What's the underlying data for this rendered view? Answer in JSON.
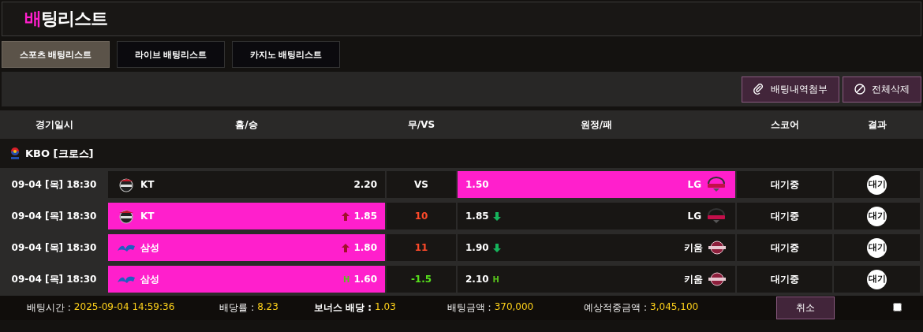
{
  "title": {
    "accent": "배",
    "rest": "팅리스트"
  },
  "tabs": [
    {
      "label": "스포츠 배팅리스트",
      "selected": true
    },
    {
      "label": "라이브 배팅리스트",
      "selected": false
    },
    {
      "label": "카지노 배팅리스트",
      "selected": false
    }
  ],
  "toolbar": [
    {
      "label": "배팅내역첨부",
      "kind": "attach"
    },
    {
      "label": "전체삭제",
      "kind": "delete"
    }
  ],
  "columns": [
    "경기일시",
    "홈/승",
    "무/VS",
    "원정/패",
    "스코어",
    "결과"
  ],
  "league": {
    "name": "KBO [크로스]"
  },
  "rows": [
    {
      "date": "09-04 [목] 18:30",
      "home": {
        "name": "KT",
        "kind": "dark-badge",
        "odds": "2.20",
        "selected": false
      },
      "draw": {
        "text": "VS",
        "kind": "vs"
      },
      "away": {
        "name": "LG",
        "kind": "arc-badge",
        "odds": "1.50",
        "selected": true
      },
      "score": "대기중",
      "result": "대기"
    },
    {
      "date": "09-04 [목] 18:30",
      "home": {
        "name": "KT",
        "kind": "dark-badge",
        "odds": "1.85",
        "selected": true,
        "trend": {
          "kind": "up"
        }
      },
      "draw": {
        "text": "10",
        "kind": "total"
      },
      "away": {
        "name": "LG",
        "kind": "arc-badge",
        "odds": "1.85",
        "selected": false,
        "trend": {
          "kind": "down"
        }
      },
      "score": "대기중",
      "result": "대기"
    },
    {
      "date": "09-04 [목] 18:30",
      "home": {
        "name": "삼성",
        "kind": "script",
        "odds": "1.80",
        "selected": true,
        "trend": {
          "kind": "up"
        }
      },
      "draw": {
        "text": "11",
        "kind": "total"
      },
      "away": {
        "name": "키움",
        "kind": "ball-badge",
        "odds": "1.90",
        "selected": false,
        "trend": {
          "kind": "down"
        }
      },
      "score": "대기중",
      "result": "대기"
    },
    {
      "date": "09-04 [목] 18:30",
      "home": {
        "name": "삼성",
        "kind": "script",
        "odds": "1.60",
        "selected": true,
        "trend": {
          "kind": "letter",
          "text": "H"
        }
      },
      "draw": {
        "text": "-1.5",
        "kind": "handicap"
      },
      "away": {
        "name": "키움",
        "kind": "ball-badge",
        "odds": "2.10",
        "selected": false,
        "trend": {
          "kind": "letter",
          "text": "H"
        }
      },
      "score": "대기중",
      "result": "대기"
    }
  ],
  "summary": [
    {
      "label": "배팅시간 :",
      "value": "2025-09-04 14:59:36",
      "emphasis": false
    },
    {
      "label": "배당률 :",
      "value": "8.23",
      "emphasis": false
    },
    {
      "label": "보너스 배당 :",
      "value": "1.03",
      "emphasis": true
    },
    {
      "label": "배팅금액 :",
      "value": "370,000",
      "emphasis": false
    },
    {
      "label": "예상적중금액 :",
      "value": "3,045,100",
      "emphasis": false
    }
  ],
  "cancel_button": "취소",
  "select_checkbox": {
    "checked": false
  }
}
